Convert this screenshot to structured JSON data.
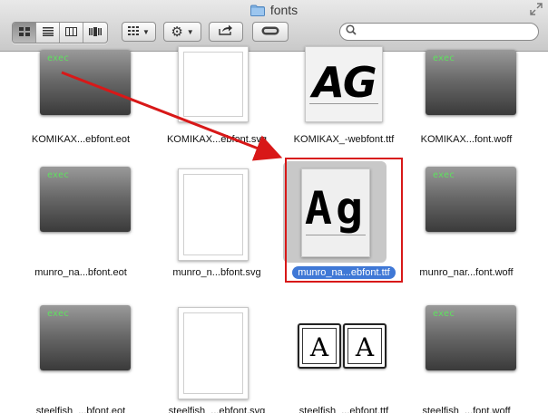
{
  "window": {
    "title": "fonts",
    "icons": {
      "folder": "folder-icon",
      "fullscreen": "fullscreen-icon"
    }
  },
  "toolbar": {
    "view_buttons": [
      {
        "name": "icon-view-button",
        "icon": "grid-icon",
        "active": true
      },
      {
        "name": "list-view-button",
        "icon": "list-icon",
        "active": false
      },
      {
        "name": "column-view-button",
        "icon": "columns-icon",
        "active": false
      },
      {
        "name": "coverflow-view-button",
        "icon": "coverflow-icon",
        "active": false
      }
    ],
    "arrange_icon": "arrange-icon",
    "action_icon": "gear-icon",
    "share_icon": "share-icon",
    "tags_icon": "tags-icon",
    "search": {
      "value": "",
      "placeholder": ""
    }
  },
  "files": [
    {
      "name": "KOMIKAX...ebfont.eot",
      "kind": "exec"
    },
    {
      "name": "KOMIKAX...ebfont.svg",
      "kind": "blank"
    },
    {
      "name": "KOMIKAX_-webfont.ttf",
      "kind": "font-komika",
      "preview": "AG"
    },
    {
      "name": "KOMIKAX...font.woff",
      "kind": "exec"
    },
    {
      "name": "munro_na...bfont.eot",
      "kind": "exec"
    },
    {
      "name": "munro_n...bfont.svg",
      "kind": "blank"
    },
    {
      "name": "munro_na...ebfont.ttf",
      "kind": "font-munro",
      "preview": "Ag",
      "selected": true
    },
    {
      "name": "munro_nar...font.woff",
      "kind": "exec"
    },
    {
      "name": "steelfish_...bfont.eot",
      "kind": "exec"
    },
    {
      "name": "steelfish_...ebfont.svg",
      "kind": "blank"
    },
    {
      "name": "steelfish_...ebfont.ttf",
      "kind": "font-steelfish",
      "preview": "A"
    },
    {
      "name": "steelfish_...font.woff",
      "kind": "exec"
    }
  ],
  "exec_label": "exec",
  "colors": {
    "selection": "#3f78d6",
    "annotation": "#d81818",
    "exec_text": "#5fe05f"
  }
}
